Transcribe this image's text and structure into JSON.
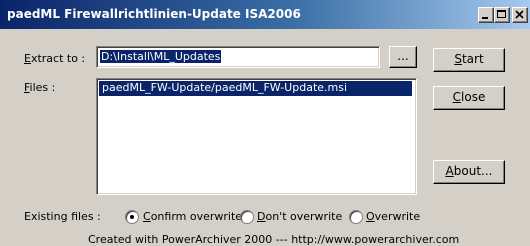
{
  "window": {
    "title": "paedML Firewallrichtlinien-Update ISA2006"
  },
  "extract": {
    "label_pre": "",
    "label_mnemonic": "E",
    "label_post": "xtract to :",
    "value": "D:\\Install\\ML_Updates",
    "browse_label": "..."
  },
  "files": {
    "label_mnemonic": "F",
    "label_post": "iles :",
    "items": [
      "paedML_FW-Update/paedML_FW-Update.msi"
    ]
  },
  "buttons": {
    "start": {
      "mnemonic": "S",
      "rest": "tart"
    },
    "close": {
      "mnemonic": "C",
      "rest": "lose"
    },
    "about": {
      "mnemonic": "A",
      "rest": "bout..."
    }
  },
  "existing": {
    "label": "Existing files :",
    "options": [
      {
        "mnemonic": "C",
        "rest": "onfirm overwrite",
        "selected": true
      },
      {
        "mnemonic": "D",
        "rest": "on't overwrite",
        "selected": false
      },
      {
        "mnemonic": "O",
        "rest": "verwrite",
        "selected": false
      }
    ]
  },
  "footer": "Created with PowerArchiver 2000 --- http://www.powerarchiver.com"
}
